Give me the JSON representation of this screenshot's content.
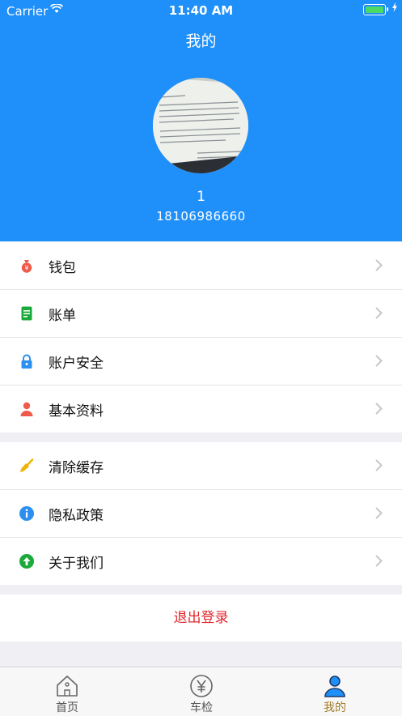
{
  "status_bar": {
    "carrier": "Carrier",
    "time": "11:40 AM"
  },
  "header": {
    "title": "我的",
    "user_name": "1",
    "phone": "18106986660"
  },
  "menu_group1": [
    {
      "label": "钱包",
      "icon": "money-bag-icon"
    },
    {
      "label": "账单",
      "icon": "bill-icon"
    },
    {
      "label": "账户安全",
      "icon": "lock-icon"
    },
    {
      "label": "基本资料",
      "icon": "person-icon"
    }
  ],
  "menu_group2": [
    {
      "label": "清除缓存",
      "icon": "broom-icon"
    },
    {
      "label": "隐私政策",
      "icon": "info-icon"
    },
    {
      "label": "关于我们",
      "icon": "arrow-up-icon"
    }
  ],
  "logout": {
    "label": "退出登录"
  },
  "tabs": [
    {
      "label": "首页",
      "icon": "home-icon"
    },
    {
      "label": "车检",
      "icon": "yen-icon"
    },
    {
      "label": "我的",
      "icon": "user-icon",
      "active": true
    }
  ],
  "colors": {
    "primary": "#1f8ffa",
    "logout": "#e0262c",
    "tab_active": "#a57c27"
  }
}
